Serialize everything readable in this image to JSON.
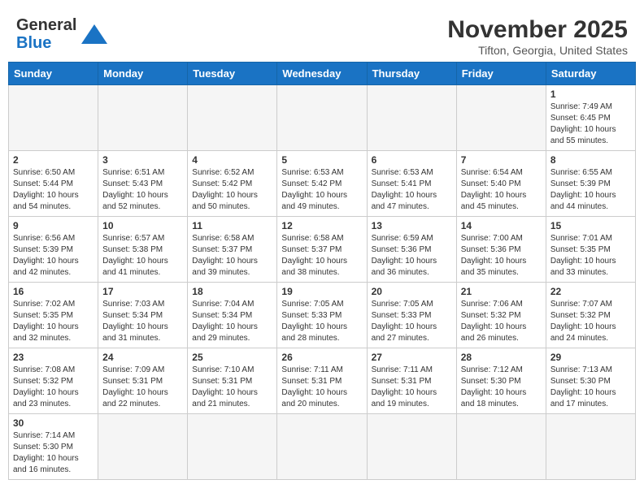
{
  "header": {
    "logo_general": "General",
    "logo_blue": "Blue",
    "month_title": "November 2025",
    "location": "Tifton, Georgia, United States"
  },
  "weekdays": [
    "Sunday",
    "Monday",
    "Tuesday",
    "Wednesday",
    "Thursday",
    "Friday",
    "Saturday"
  ],
  "weeks": [
    [
      {
        "day": "",
        "info": ""
      },
      {
        "day": "",
        "info": ""
      },
      {
        "day": "",
        "info": ""
      },
      {
        "day": "",
        "info": ""
      },
      {
        "day": "",
        "info": ""
      },
      {
        "day": "",
        "info": ""
      },
      {
        "day": "1",
        "info": "Sunrise: 7:49 AM\nSunset: 6:45 PM\nDaylight: 10 hours\nand 55 minutes."
      }
    ],
    [
      {
        "day": "2",
        "info": "Sunrise: 6:50 AM\nSunset: 5:44 PM\nDaylight: 10 hours\nand 54 minutes."
      },
      {
        "day": "3",
        "info": "Sunrise: 6:51 AM\nSunset: 5:43 PM\nDaylight: 10 hours\nand 52 minutes."
      },
      {
        "day": "4",
        "info": "Sunrise: 6:52 AM\nSunset: 5:42 PM\nDaylight: 10 hours\nand 50 minutes."
      },
      {
        "day": "5",
        "info": "Sunrise: 6:53 AM\nSunset: 5:42 PM\nDaylight: 10 hours\nand 49 minutes."
      },
      {
        "day": "6",
        "info": "Sunrise: 6:53 AM\nSunset: 5:41 PM\nDaylight: 10 hours\nand 47 minutes."
      },
      {
        "day": "7",
        "info": "Sunrise: 6:54 AM\nSunset: 5:40 PM\nDaylight: 10 hours\nand 45 minutes."
      },
      {
        "day": "8",
        "info": "Sunrise: 6:55 AM\nSunset: 5:39 PM\nDaylight: 10 hours\nand 44 minutes."
      }
    ],
    [
      {
        "day": "9",
        "info": "Sunrise: 6:56 AM\nSunset: 5:39 PM\nDaylight: 10 hours\nand 42 minutes."
      },
      {
        "day": "10",
        "info": "Sunrise: 6:57 AM\nSunset: 5:38 PM\nDaylight: 10 hours\nand 41 minutes."
      },
      {
        "day": "11",
        "info": "Sunrise: 6:58 AM\nSunset: 5:37 PM\nDaylight: 10 hours\nand 39 minutes."
      },
      {
        "day": "12",
        "info": "Sunrise: 6:58 AM\nSunset: 5:37 PM\nDaylight: 10 hours\nand 38 minutes."
      },
      {
        "day": "13",
        "info": "Sunrise: 6:59 AM\nSunset: 5:36 PM\nDaylight: 10 hours\nand 36 minutes."
      },
      {
        "day": "14",
        "info": "Sunrise: 7:00 AM\nSunset: 5:36 PM\nDaylight: 10 hours\nand 35 minutes."
      },
      {
        "day": "15",
        "info": "Sunrise: 7:01 AM\nSunset: 5:35 PM\nDaylight: 10 hours\nand 33 minutes."
      }
    ],
    [
      {
        "day": "16",
        "info": "Sunrise: 7:02 AM\nSunset: 5:35 PM\nDaylight: 10 hours\nand 32 minutes."
      },
      {
        "day": "17",
        "info": "Sunrise: 7:03 AM\nSunset: 5:34 PM\nDaylight: 10 hours\nand 31 minutes."
      },
      {
        "day": "18",
        "info": "Sunrise: 7:04 AM\nSunset: 5:34 PM\nDaylight: 10 hours\nand 29 minutes."
      },
      {
        "day": "19",
        "info": "Sunrise: 7:05 AM\nSunset: 5:33 PM\nDaylight: 10 hours\nand 28 minutes."
      },
      {
        "day": "20",
        "info": "Sunrise: 7:05 AM\nSunset: 5:33 PM\nDaylight: 10 hours\nand 27 minutes."
      },
      {
        "day": "21",
        "info": "Sunrise: 7:06 AM\nSunset: 5:32 PM\nDaylight: 10 hours\nand 26 minutes."
      },
      {
        "day": "22",
        "info": "Sunrise: 7:07 AM\nSunset: 5:32 PM\nDaylight: 10 hours\nand 24 minutes."
      }
    ],
    [
      {
        "day": "23",
        "info": "Sunrise: 7:08 AM\nSunset: 5:32 PM\nDaylight: 10 hours\nand 23 minutes."
      },
      {
        "day": "24",
        "info": "Sunrise: 7:09 AM\nSunset: 5:31 PM\nDaylight: 10 hours\nand 22 minutes."
      },
      {
        "day": "25",
        "info": "Sunrise: 7:10 AM\nSunset: 5:31 PM\nDaylight: 10 hours\nand 21 minutes."
      },
      {
        "day": "26",
        "info": "Sunrise: 7:11 AM\nSunset: 5:31 PM\nDaylight: 10 hours\nand 20 minutes."
      },
      {
        "day": "27",
        "info": "Sunrise: 7:11 AM\nSunset: 5:31 PM\nDaylight: 10 hours\nand 19 minutes."
      },
      {
        "day": "28",
        "info": "Sunrise: 7:12 AM\nSunset: 5:30 PM\nDaylight: 10 hours\nand 18 minutes."
      },
      {
        "day": "29",
        "info": "Sunrise: 7:13 AM\nSunset: 5:30 PM\nDaylight: 10 hours\nand 17 minutes."
      }
    ],
    [
      {
        "day": "30",
        "info": "Sunrise: 7:14 AM\nSunset: 5:30 PM\nDaylight: 10 hours\nand 16 minutes."
      },
      {
        "day": "",
        "info": ""
      },
      {
        "day": "",
        "info": ""
      },
      {
        "day": "",
        "info": ""
      },
      {
        "day": "",
        "info": ""
      },
      {
        "day": "",
        "info": ""
      },
      {
        "day": "",
        "info": ""
      }
    ]
  ]
}
